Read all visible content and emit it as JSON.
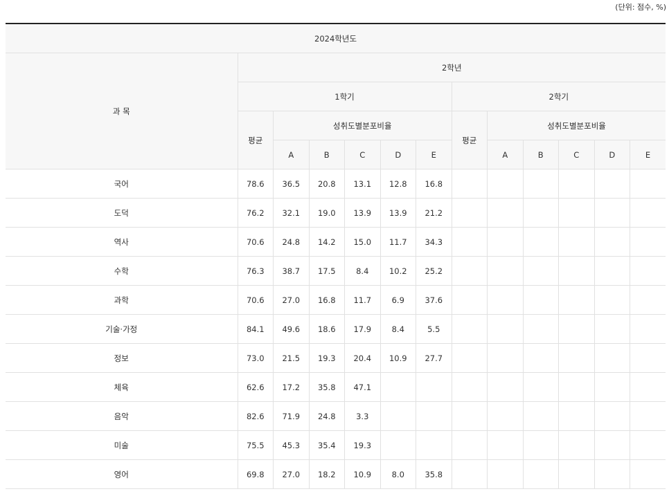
{
  "unit_note": "(단위: 점수, %)",
  "header": {
    "year": "2024학년도",
    "subject_col": "과 목",
    "grade": "2학년",
    "semesters": [
      "1학기",
      "2학기"
    ],
    "average": "평균",
    "distribution": "성취도별분포비율",
    "levels": [
      "A",
      "B",
      "C",
      "D",
      "E"
    ]
  },
  "rows": [
    {
      "subject": "국어",
      "s1": [
        "78.6",
        "36.5",
        "20.8",
        "13.1",
        "12.8",
        "16.8"
      ],
      "s2": [
        "",
        "",
        "",
        "",
        "",
        ""
      ]
    },
    {
      "subject": "도덕",
      "s1": [
        "76.2",
        "32.1",
        "19.0",
        "13.9",
        "13.9",
        "21.2"
      ],
      "s2": [
        "",
        "",
        "",
        "",
        "",
        ""
      ]
    },
    {
      "subject": "역사",
      "s1": [
        "70.6",
        "24.8",
        "14.2",
        "15.0",
        "11.7",
        "34.3"
      ],
      "s2": [
        "",
        "",
        "",
        "",
        "",
        ""
      ]
    },
    {
      "subject": "수학",
      "s1": [
        "76.3",
        "38.7",
        "17.5",
        "8.4",
        "10.2",
        "25.2"
      ],
      "s2": [
        "",
        "",
        "",
        "",
        "",
        ""
      ]
    },
    {
      "subject": "과학",
      "s1": [
        "70.6",
        "27.0",
        "16.8",
        "11.7",
        "6.9",
        "37.6"
      ],
      "s2": [
        "",
        "",
        "",
        "",
        "",
        ""
      ]
    },
    {
      "subject": "기술·가정",
      "s1": [
        "84.1",
        "49.6",
        "18.6",
        "17.9",
        "8.4",
        "5.5"
      ],
      "s2": [
        "",
        "",
        "",
        "",
        "",
        ""
      ]
    },
    {
      "subject": "정보",
      "s1": [
        "73.0",
        "21.5",
        "19.3",
        "20.4",
        "10.9",
        "27.7"
      ],
      "s2": [
        "",
        "",
        "",
        "",
        "",
        ""
      ]
    },
    {
      "subject": "체육",
      "s1": [
        "62.6",
        "17.2",
        "35.8",
        "47.1",
        "",
        ""
      ],
      "s2": [
        "",
        "",
        "",
        "",
        "",
        ""
      ]
    },
    {
      "subject": "음악",
      "s1": [
        "82.6",
        "71.9",
        "24.8",
        "3.3",
        "",
        ""
      ],
      "s2": [
        "",
        "",
        "",
        "",
        "",
        ""
      ]
    },
    {
      "subject": "미술",
      "s1": [
        "75.5",
        "45.3",
        "35.4",
        "19.3",
        "",
        ""
      ],
      "s2": [
        "",
        "",
        "",
        "",
        "",
        ""
      ]
    },
    {
      "subject": "영어",
      "s1": [
        "69.8",
        "27.0",
        "18.2",
        "10.9",
        "8.0",
        "35.8"
      ],
      "s2": [
        "",
        "",
        "",
        "",
        "",
        ""
      ]
    }
  ]
}
